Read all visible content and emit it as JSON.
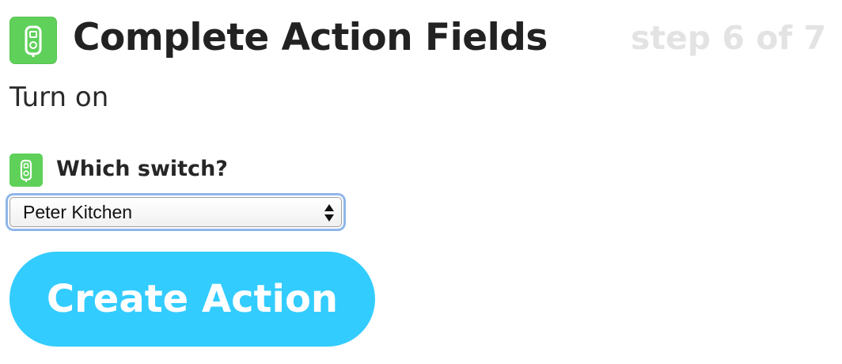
{
  "header": {
    "title": "Complete Action Fields",
    "step": "step 6 of 7",
    "service_icon": "smart-plug-icon"
  },
  "action": {
    "name": "Turn on"
  },
  "field": {
    "label": "Which switch?",
    "icon": "smart-plug-icon",
    "selected_value": "Peter Kitchen"
  },
  "submit": {
    "label": "Create Action"
  },
  "colors": {
    "service_green": "#5fd05a",
    "button_blue": "#33ccff",
    "step_gray": "#e3e3e3",
    "focus_ring": "#8fb6ea"
  }
}
